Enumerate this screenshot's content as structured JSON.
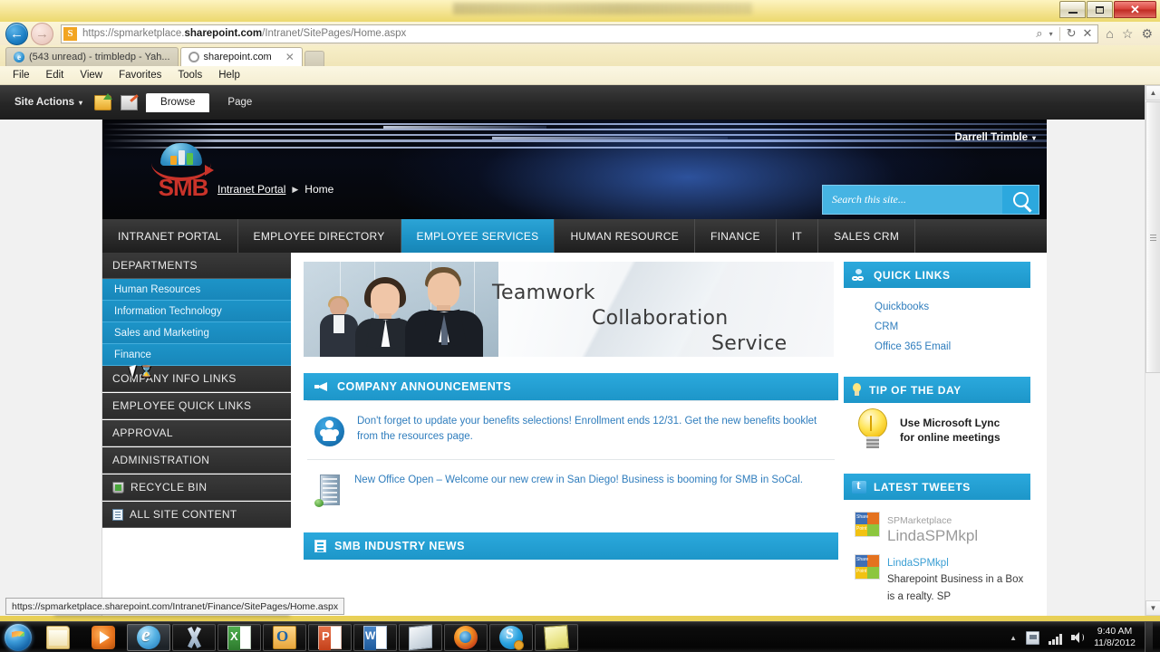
{
  "browser": {
    "window_buttons": {
      "minimize": "minimize-button",
      "maximize": "maximize-button",
      "close": "✕"
    },
    "nav": {
      "back": "←",
      "forward": "→"
    },
    "ssl_badge": "S",
    "url_prefix": "https://spmarketplace.",
    "url_domain": "sharepoint.com",
    "url_suffix": "/Intranet/SitePages/Home.aspx",
    "url_full": "https://spmarketplace.sharepoint.com/Intranet/SitePages/Home.aspx",
    "url_icons": {
      "search": "⌕",
      "search_caret": "▾",
      "refresh": "↻",
      "stop": "✕"
    },
    "toolbar_icons": {
      "home": "⌂",
      "favorites": "☆",
      "tools": "⚙"
    },
    "tabs": [
      {
        "label": "(543 unread) - trimbledp - Yah...",
        "active": false,
        "favicon": "ie-favicon"
      },
      {
        "label": "sharepoint.com",
        "active": true,
        "favicon": "loading-spinner-icon",
        "close": "✕"
      }
    ],
    "menu": [
      "File",
      "Edit",
      "View",
      "Favorites",
      "Tools",
      "Help"
    ],
    "status_url": "https://spmarketplace.sharepoint.com/Intranet/Finance/SitePages/Home.aspx"
  },
  "ribbon": {
    "site_actions": "Site Actions",
    "site_actions_caret": "▾",
    "icons": [
      "navigate-up-icon",
      "edit-page-icon"
    ],
    "tabs": [
      {
        "label": "Browse",
        "active": true
      },
      {
        "label": "Page",
        "active": false
      }
    ]
  },
  "header": {
    "logo_text": "SMB",
    "username": "Darrell Trimble",
    "username_caret": "▾",
    "breadcrumb": {
      "root": "Intranet Portal",
      "separator": "▶",
      "current": "Home"
    },
    "search": {
      "placeholder": "Search this site...",
      "value": "",
      "button": "search-button"
    }
  },
  "topnav": [
    {
      "label": "INTRANET PORTAL",
      "active": false
    },
    {
      "label": "EMPLOYEE DIRECTORY",
      "active": false
    },
    {
      "label": "EMPLOYEE SERVICES",
      "active": true
    },
    {
      "label": "HUMAN RESOURCE",
      "active": false
    },
    {
      "label": "FINANCE",
      "active": false
    },
    {
      "label": "IT",
      "active": false
    },
    {
      "label": "SALES CRM",
      "active": false
    }
  ],
  "leftnav": [
    {
      "label": "DEPARTMENTS",
      "type": "header"
    },
    {
      "label": "Human Resources",
      "type": "sub"
    },
    {
      "label": "Information Technology",
      "type": "sub"
    },
    {
      "label": "Sales and Marketing",
      "type": "sub"
    },
    {
      "label": "Finance",
      "type": "sub"
    },
    {
      "label": "COMPANY INFO LINKS",
      "type": "header"
    },
    {
      "label": "EMPLOYEE QUICK LINKS",
      "type": "header"
    },
    {
      "label": "APPROVAL",
      "type": "header"
    },
    {
      "label": "ADMINISTRATION",
      "type": "header"
    },
    {
      "label": "RECYCLE BIN",
      "type": "header",
      "icon": "recycle-bin-icon"
    },
    {
      "label": "ALL SITE CONTENT",
      "type": "header",
      "icon": "all-site-content-icon"
    }
  ],
  "hero": {
    "line1": "Teamwork",
    "line2": "Collaboration",
    "line3": "Service"
  },
  "announcements": {
    "title": "COMPANY ANNOUNCEMENTS",
    "icon": "megaphone-icon",
    "items": [
      {
        "icon": "people-group-icon",
        "text": "Don't forget to update your benefits selections! Enrollment ends 12/31. Get the new benefits booklet from the resources page."
      },
      {
        "icon": "office-building-icon",
        "text": "New Office Open – Welcome our new crew in San Diego! Business is booming for SMB in SoCal."
      }
    ]
  },
  "industry_news": {
    "title": "SMB INDUSTRY NEWS",
    "icon": "news-icon"
  },
  "quick_links": {
    "title": "QUICK LINKS",
    "icon": "links-icon",
    "items": [
      "Quickbooks",
      "CRM",
      "Office 365 Email"
    ]
  },
  "tip_of_the_day": {
    "title": "TIP OF THE DAY",
    "icon": "lightbulb-icon",
    "text_line1": "Use Microsoft Lync",
    "text_line2": "for online meetings"
  },
  "latest_tweets": {
    "title": "LATEST TWEETS",
    "icon": "twitter-icon",
    "items": [
      {
        "account": "SPMarketplace",
        "handle": "LindaSPMkpl",
        "text": ""
      },
      {
        "account": "",
        "handle": "LindaSPMkpl",
        "text": "Sharepoint Business in a Box is a realty. SP"
      }
    ]
  },
  "taskbar": {
    "start": "start-orb",
    "items": [
      {
        "name": "windows-explorer",
        "icon": "explorer-icon",
        "state": "pinned"
      },
      {
        "name": "windows-media-player",
        "icon": "media-player-icon",
        "state": "pinned"
      },
      {
        "name": "internet-explorer",
        "icon": "ie-icon",
        "state": "active"
      },
      {
        "name": "x-app",
        "icon": "x-icon",
        "state": "running"
      },
      {
        "name": "microsoft-excel",
        "icon": "excel-icon",
        "state": "running"
      },
      {
        "name": "microsoft-outlook",
        "icon": "outlook-icon",
        "state": "running"
      },
      {
        "name": "microsoft-powerpoint",
        "icon": "powerpoint-icon",
        "state": "running"
      },
      {
        "name": "microsoft-word",
        "icon": "word-icon",
        "state": "running"
      },
      {
        "name": "notebook-app",
        "icon": "notebook-icon",
        "state": "running"
      },
      {
        "name": "mozilla-firefox",
        "icon": "firefox-icon",
        "state": "running"
      },
      {
        "name": "skype",
        "icon": "skype-icon",
        "state": "running"
      },
      {
        "name": "sticky-notes",
        "icon": "sticky-notes-icon",
        "state": "running"
      }
    ],
    "tray": {
      "expand": "▲",
      "icons": [
        "action-center-icon",
        "network-icon",
        "volume-icon"
      ],
      "time": "9:40 AM",
      "date": "11/8/2012"
    }
  },
  "colors": {
    "accent_blue": "#1d96c9",
    "header_blue": "#2ba9dd",
    "nav_active": "#1d93c6",
    "link_blue": "#2f7dbd",
    "sidebar_sub": "#1d94c8",
    "dark_nav": "#2c2c2c",
    "logo_red": "#c9332a"
  }
}
